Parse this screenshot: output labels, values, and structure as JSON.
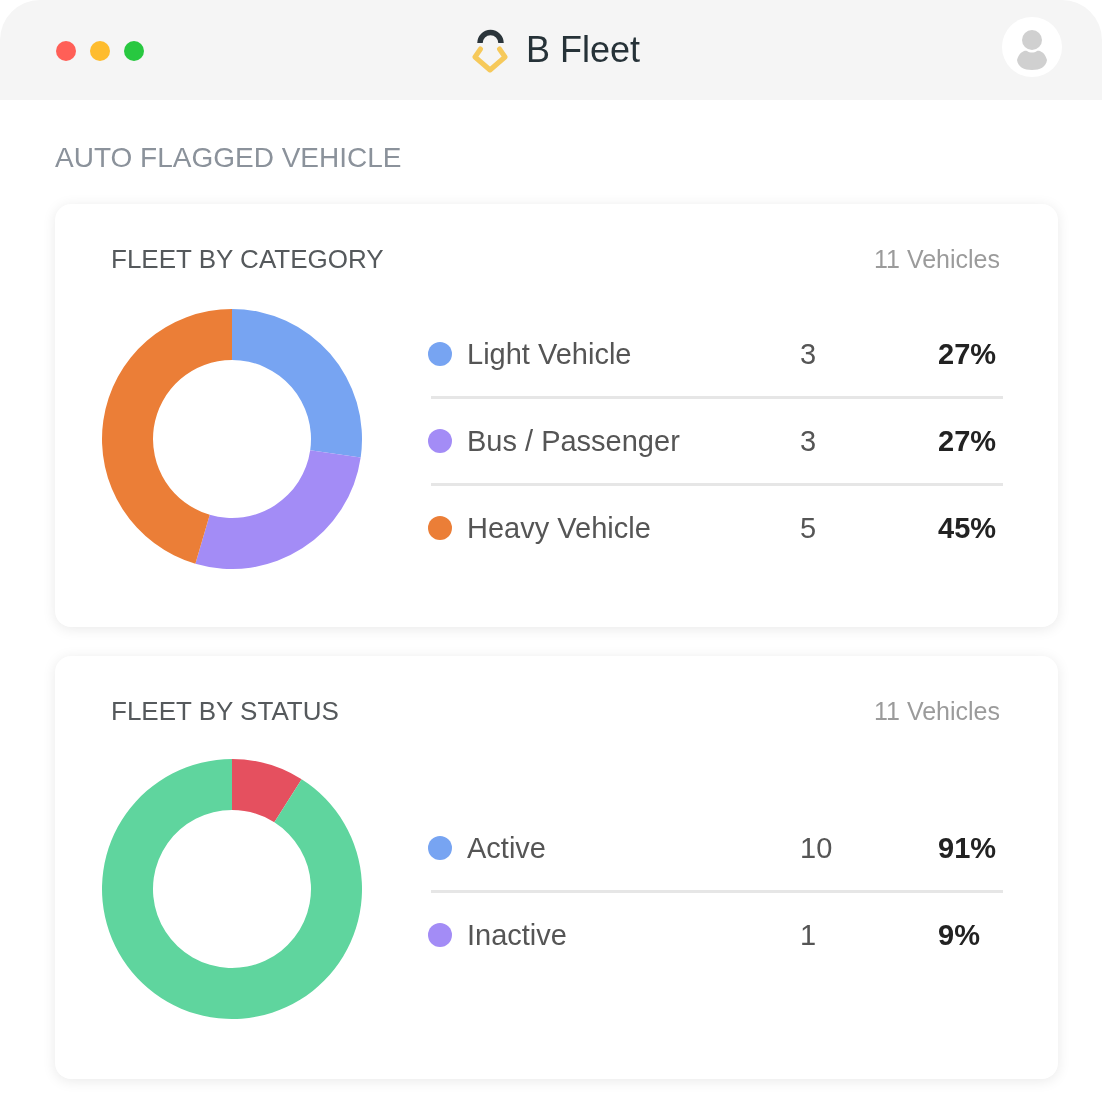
{
  "window": {
    "app_title": "B Fleet"
  },
  "section_title": "AUTO FLAGGED VEHICLE",
  "cards": [
    {
      "title": "FLEET BY CATEGORY",
      "total": "11 Vehicles",
      "chart_data": {
        "type": "donut",
        "values": [
          27,
          27,
          45
        ],
        "colors": [
          "#77a4f2",
          "#a38cf6",
          "#eb7e37"
        ]
      },
      "legend": [
        {
          "label": "Light Vehicle",
          "count": "3",
          "percent": "27%",
          "color": "#77a4f2"
        },
        {
          "label": "Bus / Passenger",
          "count": "3",
          "percent": "27%",
          "color": "#a38cf6"
        },
        {
          "label": "Heavy Vehicle",
          "count": "5",
          "percent": "45%",
          "color": "#eb7e37"
        }
      ]
    },
    {
      "title": "FLEET BY STATUS",
      "total": "11 Vehicles",
      "chart_data": {
        "type": "donut",
        "values": [
          9,
          91
        ],
        "colors": [
          "#e5505f",
          "#5fd59e"
        ]
      },
      "legend": [
        {
          "label": "Active",
          "count": "10",
          "percent": "91%",
          "color": "#77a4f2"
        },
        {
          "label": "Inactive",
          "count": "1",
          "percent": "9%",
          "color": "#a38cf6"
        }
      ]
    }
  ]
}
